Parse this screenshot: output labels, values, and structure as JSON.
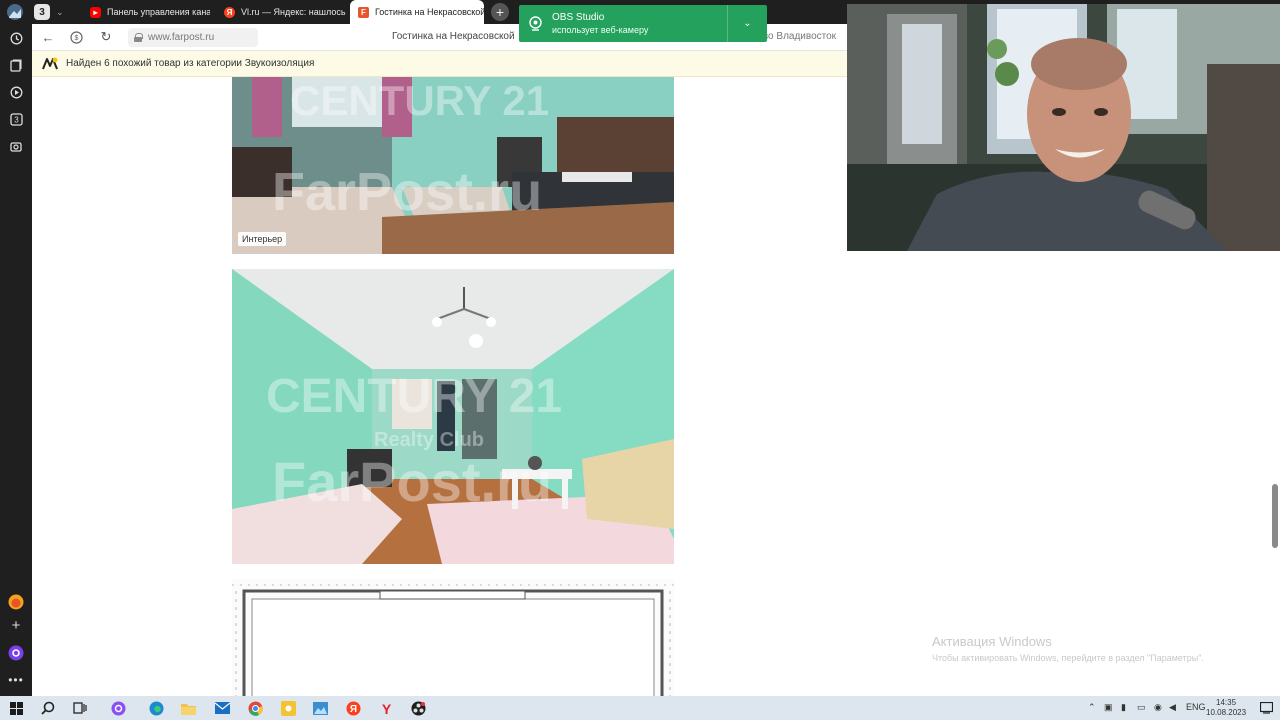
{
  "browser": {
    "tab_counter": "3",
    "tabs": [
      {
        "label": "Панель управления канала",
        "favicon_color": "#ff0000"
      },
      {
        "label": "Vl.ru — Яндекс: нашлось",
        "favicon_color": "#fc3f1d"
      },
      {
        "label": "Гостинка на Некрасовской",
        "favicon_color": "#e8552c",
        "active": true
      }
    ],
    "url": "www.farpost.ru",
    "page_title": "Гостинка на Некрасовской",
    "page_title_rest": "купить Гостинка квартиру во Владивосток"
  },
  "infobar": {
    "text": "Найден 6 похожий товар из категории Звукоизоляция"
  },
  "notification": {
    "app": "OBS Studio",
    "message": "использует веб-камеру"
  },
  "photos": [
    {
      "badge": "Интерьер",
      "watermark_1": "CENTURY 21",
      "watermark_2": "FarPost.ru"
    },
    {
      "watermark_1": "CENTURY 21",
      "watermark_2": "Realty Club",
      "watermark_3": "FarPost.ru"
    }
  ],
  "windows_activation": {
    "title": "Активация Windows",
    "subtitle": "Чтобы активировать Windows, перейдите в раздел \"Параметры\"."
  },
  "taskbar": {
    "lang": "ENG",
    "time": "14:35",
    "date": "10.08.2023"
  },
  "colors": {
    "chrome_dark": "#1f1f1f",
    "obs_green": "#24a15c",
    "infobar_bg": "#fdfae6",
    "taskbar_bg": "#dde6ef"
  }
}
